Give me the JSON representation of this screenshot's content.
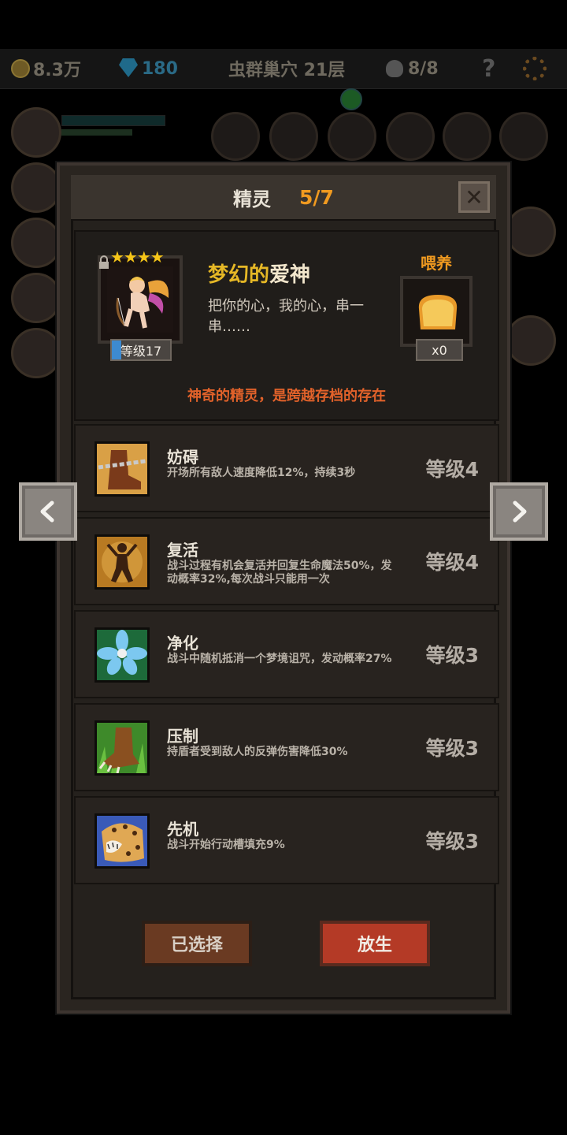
{
  "topbar": {
    "coins": "8.3万",
    "gems": "180",
    "location": "虫群巢穴 21层",
    "kills": "8/8",
    "help_symbol": "?"
  },
  "dialog": {
    "title": "精灵",
    "count": "5/7",
    "close_symbol": "✕"
  },
  "spirit": {
    "stars": "★★★★",
    "level": "等级17",
    "name_part1": "梦幻的",
    "name_part2": "爱神",
    "description": "把你的心，我的心，串一串……",
    "feed_label": "喂养",
    "feed_count": "x0",
    "tagline": "神奇的精灵，是跨越存档的存在"
  },
  "skills": [
    {
      "name": "妨碍",
      "desc": "开场所有敌人速度降低12%，持续3秒",
      "level": "等级4",
      "icon": "chain-boot-icon"
    },
    {
      "name": "复活",
      "desc": "战斗过程有机会复活并回复生命魔法50%，发动概率32%,每次战斗只能用一次",
      "level": "等级4",
      "icon": "revive-figure-icon"
    },
    {
      "name": "净化",
      "desc": "战斗中随机抵消一个梦境诅咒，发动概率27%",
      "level": "等级3",
      "icon": "blue-flower-icon"
    },
    {
      "name": "压制",
      "desc": "持盾者受到敌人的反弹伤害降低30%",
      "level": "等级3",
      "icon": "beast-claw-icon"
    },
    {
      "name": "先机",
      "desc": "战斗开始行动槽填充9%",
      "level": "等级3",
      "icon": "leopard-icon"
    }
  ],
  "buttons": {
    "selected": "已选择",
    "release": "放生"
  },
  "colors": {
    "accent_orange": "#f09a20",
    "tagline_red": "#e2622a",
    "name_gold": "#e6b826",
    "release_red": "#b43a26"
  }
}
